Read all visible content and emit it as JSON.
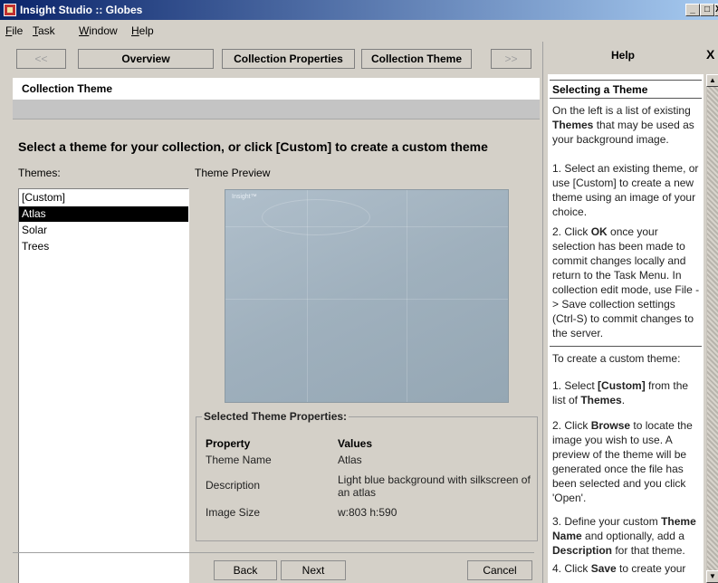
{
  "window": {
    "title": "Insight Studio :: Globes",
    "controls": [
      "_",
      "□",
      "X"
    ]
  },
  "menu": [
    {
      "label": "File",
      "underline": "F",
      "rest": "ile"
    },
    {
      "label": "Task",
      "underline": "T",
      "rest": "ask"
    },
    {
      "label": "Window",
      "underline": "W",
      "rest": "indow"
    },
    {
      "label": "Help",
      "underline": "H",
      "rest": "elp"
    }
  ],
  "wizard": {
    "prev": "<<",
    "steps": [
      "Overview",
      "Collection Properties",
      "Collection Theme"
    ],
    "next": ">>",
    "page_title": "Collection Theme",
    "instruction": "Select a theme for your collection, or click [Custom] to create a custom theme",
    "themes_label": "Themes:",
    "preview_label": "Theme Preview",
    "preview_brand": "Insight™"
  },
  "themes": {
    "items": [
      "[Custom]",
      "Atlas",
      "Solar",
      "Trees"
    ],
    "selected": "Atlas"
  },
  "properties": {
    "legend": "Selected Theme Properties:",
    "col_property": "Property",
    "col_values": "Values",
    "rows": [
      {
        "property": "Theme Name",
        "value": "Atlas"
      },
      {
        "property": "Description",
        "value": "Light blue background with silkscreen of an atlas"
      },
      {
        "property": "Image Size",
        "value": "w:803 h:590"
      }
    ]
  },
  "buttons": {
    "back": "Back",
    "next": "Next",
    "cancel": "Cancel"
  },
  "help": {
    "title": "Help",
    "close": "X",
    "heading": "Selecting a Theme",
    "p1_a": "On the left is a list of existing ",
    "p1_b": "Themes",
    "p1_c": " that may be used as your background image.",
    "p2": "1. Select an existing theme, or use [Custom] to create a new theme using an image of your choice.",
    "p3_a": "2. Click ",
    "p3_b": "OK",
    "p3_c": " once your selection has been made to commit changes locally and return to the Task Menu. In collection edit mode, use File -> Save collection settings (Ctrl-S) to commit changes to the server.",
    "p4": "To create a custom theme:",
    "p5_a": "1. Select ",
    "p5_b": "[Custom]",
    "p5_c": " from the list of ",
    "p5_d": "Themes",
    "p5_e": ".",
    "p6_a": "2. Click ",
    "p6_b": "Browse",
    "p6_c": " to locate the image you wish to use. A preview of the theme will be generated once the file has been selected and you click 'Open'.",
    "p7_a": "3. Define your custom ",
    "p7_b": "Theme Name",
    "p7_c": " and optionally, add a ",
    "p7_d": "Description",
    "p7_e": " for that theme.",
    "p8_a": "4. Click ",
    "p8_b": "Save",
    "p8_c": " to create your"
  }
}
